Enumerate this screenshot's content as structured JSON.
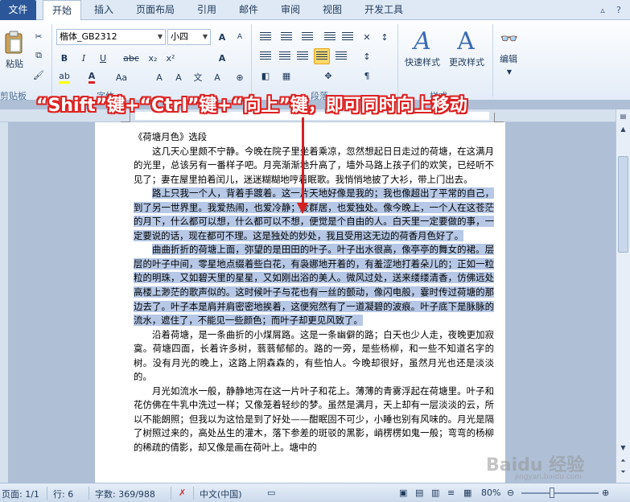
{
  "tabs": [
    "文件",
    "开始",
    "插入",
    "页面布局",
    "引用",
    "邮件",
    "审阅",
    "视图",
    "开发工具"
  ],
  "ribbon": {
    "paste_label": "粘贴",
    "clipboard_label": "剪贴板",
    "font_name": "楷体_GB2312",
    "font_size": "小四",
    "font_group_label": "字体",
    "paragraph_group_label": "段落",
    "styles_group_label": "样式",
    "quick_style_label": "快速样式",
    "change_style_label": "更改样式",
    "edit_label": "编辑",
    "bold": "B",
    "italic": "I",
    "underline": "U",
    "strike": "abc",
    "sub": "x₂",
    "sup": "x²",
    "aa": "Aa"
  },
  "banner": "“Shift”键+“Ctrl”键+“向上”键，即可同时向上移动",
  "document": {
    "heading": "《荷塘月色》选段",
    "p1": "这几天心里颇不宁静。今晚在院子里坐着乘凉，忽然想起日日走过的荷塘，在这满月的光里，总该另有一番样子吧。月亮渐渐地升高了，墙外马路上孩子们的欢笑，已经听不见了；妻在屋里拍着闰儿，迷迷糊糊地哼着眠歌。我悄悄地披了大衫，带上门出去。",
    "p2": "路上只我一个人，背着手踱着。这一片天地好像是我的；我也像超出了平常的自己，到了另一世界里。我爱热闹，也爱冷静；爱群居，也爱独处。像今晚上，一个人在这苍茫的月下，什么都可以想，什么都可以不想，便觉是个自由的人。白天里一定要做的事，一定要说的话，现在都可不理。这是独处的妙处，我且受用这无边的荷香月色好了。",
    "p3": "曲曲折折的荷塘上面，弥望的是田田的叶子。叶子出水很高，像亭亭的舞女的裙。层层的叶子中间，零星地点缀着些白花，有袅娜地开着的，有羞涩地打着朵儿的；正如一粒粒的明珠，又如碧天里的星星，又如刚出浴的美人。微风过处，送来缕缕清香，仿佛远处高楼上渺茫的歌声似的。这时候叶子与花也有一丝的颤动，像闪电般，霎时传过荷塘的那边去了。叶子本是肩并肩密密地挨着，这便宛然有了一道凝碧的波痕。叶子底下是脉脉的流水，遮住了，不能见一些颜色；而叶子却更见风致了。",
    "p4": "沿着荷塘，是一条曲折的小煤屑路。这是一条幽僻的路；白天也少人走，夜晚更加寂寞。荷塘四面，长着许多树，蓊蓊郁郁的。路的一旁，是些杨柳，和一些不知道名字的树。没有月光的晚上，这路上阴森森的，有些怕人。今晚却很好，虽然月光也还是淡淡的。",
    "p5": "月光如流水一般，静静地泻在这一片叶子和花上。薄薄的青雾浮起在荷塘里。叶子和花仿佛在牛乳中洗过一样；又像笼着轻纱的梦。虽然是满月，天上却有一层淡淡的云，所以不能朗照；但我以为这恰是到了好处——酣眠固不可少，小睡也别有风味的。月光是隔了树照过来的，高处丛生的灌木，落下参差的斑驳的黑影，峭楞楞如鬼一般；弯弯的杨柳的稀疏的倩影，却又像是画在荷叶上。塘中的"
  },
  "status": {
    "page": "页面: 1/1",
    "line": "行: 6",
    "words": "字数: 369/988",
    "lang": "中文(中国)",
    "zoom": "80%"
  },
  "watermark": "Baidu 经验",
  "watermark_sub": "jingyan.baidu.com",
  "colors": {
    "file_tab": "#2b579a",
    "selection": "#b6c8e6",
    "banner_outline": "#d22222",
    "arrow": "#d42020"
  }
}
